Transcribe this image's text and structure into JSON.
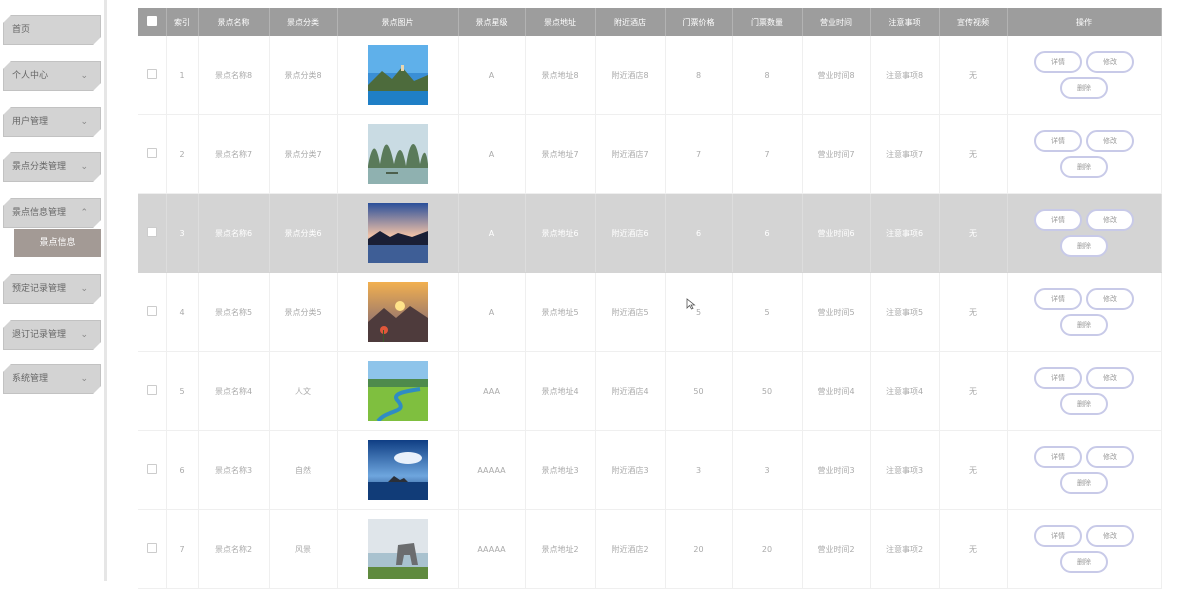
{
  "sidebar": {
    "items": [
      {
        "label": "首页",
        "chevron": ""
      },
      {
        "label": "个人中心",
        "chevron": "⌄"
      },
      {
        "label": "用户管理",
        "chevron": "⌄"
      },
      {
        "label": "景点分类管理",
        "chevron": "⌄"
      },
      {
        "label": "景点信息管理",
        "chevron": "⌃"
      },
      {
        "label": "预定记录管理",
        "chevron": "⌄"
      },
      {
        "label": "退订记录管理",
        "chevron": "⌄"
      },
      {
        "label": "系统管理",
        "chevron": "⌄"
      }
    ],
    "submenu": {
      "label": "景点信息"
    }
  },
  "table": {
    "headers": [
      "索引",
      "景点名称",
      "景点分类",
      "景点图片",
      "景点星级",
      "景点地址",
      "附近酒店",
      "门票价格",
      "门票数量",
      "营业时间",
      "注意事项",
      "宣传视频",
      "操作"
    ],
    "actions": {
      "detail": "详情",
      "edit": "修改",
      "delete": "删除"
    },
    "rows": [
      {
        "index": "1",
        "name": "景点名称8",
        "category": "景点分类8",
        "image": "lake-mountain-photo",
        "stars": "A",
        "address": "景点地址8",
        "hotel": "附近酒店8",
        "price": "8",
        "quantity": "8",
        "hours": "营业时间8",
        "notes": "注意事项8",
        "video": "无",
        "selected": false
      },
      {
        "index": "2",
        "name": "景点名称7",
        "category": "景点分类7",
        "image": "karst-mountains-photo",
        "stars": "A",
        "address": "景点地址7",
        "hotel": "附近酒店7",
        "price": "7",
        "quantity": "7",
        "hours": "营业时间7",
        "notes": "注意事项7",
        "video": "无",
        "selected": false
      },
      {
        "index": "3",
        "name": "景点名称6",
        "category": "景点分类6",
        "image": "sunset-lake-photo",
        "stars": "A",
        "address": "景点地址6",
        "hotel": "附近酒店6",
        "price": "6",
        "quantity": "6",
        "hours": "营业时间6",
        "notes": "注意事项6",
        "video": "无",
        "selected": true
      },
      {
        "index": "4",
        "name": "景点名称5",
        "category": "景点分类5",
        "image": "mountain-sunset-photo",
        "stars": "A",
        "address": "景点地址5",
        "hotel": "附近酒店5",
        "price": "5",
        "quantity": "5",
        "hours": "营业时间5",
        "notes": "注意事项5",
        "video": "无",
        "selected": false
      },
      {
        "index": "5",
        "name": "景点名称4",
        "category": "人文",
        "image": "grassland-river-photo",
        "stars": "AAA",
        "address": "景点地址4",
        "hotel": "附近酒店4",
        "price": "50",
        "quantity": "50",
        "hours": "营业时间4",
        "notes": "注意事项4",
        "video": "无",
        "selected": false
      },
      {
        "index": "6",
        "name": "景点名称3",
        "category": "自然",
        "image": "sea-island-photo",
        "stars": "AAAAA",
        "address": "景点地址3",
        "hotel": "附近酒店3",
        "price": "3",
        "quantity": "3",
        "hours": "营业时间3",
        "notes": "注意事项3",
        "video": "无",
        "selected": false
      },
      {
        "index": "7",
        "name": "景点名称2",
        "category": "风景",
        "image": "coastal-arch-photo",
        "stars": "AAAAA",
        "address": "景点地址2",
        "hotel": "附近酒店2",
        "price": "20",
        "quantity": "20",
        "hours": "营业时间2",
        "notes": "注意事项2",
        "video": "无",
        "selected": false
      }
    ]
  }
}
